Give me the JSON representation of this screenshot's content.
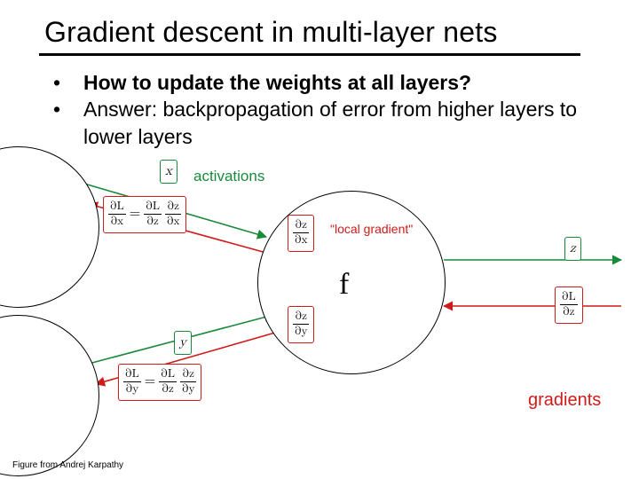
{
  "title": "Gradient descent in multi-layer nets",
  "bullets": {
    "dot": "•",
    "items": [
      {
        "text": "How to update the weights at all layers?",
        "bold": true
      },
      {
        "text": "Answer: backpropagation of error from higher layers to lower layers",
        "bold": false
      }
    ]
  },
  "credit": "Figure from Andrej Karpathy",
  "diagram": {
    "f_label": "f",
    "labels": {
      "activations": "activations",
      "local_gradient": "\"local gradient\"",
      "gradients": "gradients"
    },
    "vars": {
      "x": "x",
      "y": "y",
      "z": "z"
    },
    "math": {
      "dL": "∂L",
      "dx": "∂x",
      "dy": "∂y",
      "dz": "∂z",
      "eq": "="
    }
  },
  "chart_data": {
    "type": "diagram",
    "title": "Backpropagation computational graph node",
    "nodes": [
      {
        "name": "upstream-left-top",
        "shape": "circle-partial"
      },
      {
        "name": "upstream-left-bottom",
        "shape": "circle-partial"
      },
      {
        "name": "f",
        "shape": "circle",
        "label": "f"
      }
    ],
    "inputs": [
      {
        "symbol": "x",
        "activation_color": "green"
      },
      {
        "symbol": "y",
        "activation_color": "green"
      }
    ],
    "output": {
      "symbol": "z",
      "activation_color": "green"
    },
    "forward_edges": [
      {
        "from": "upstream-left-top",
        "to": "f",
        "carries": "x"
      },
      {
        "from": "upstream-left-bottom",
        "to": "f",
        "carries": "y"
      },
      {
        "from": "f",
        "to": "downstream-right",
        "carries": "z"
      }
    ],
    "local_gradients": [
      {
        "expr": "∂z/∂x",
        "box_color": "red"
      },
      {
        "expr": "∂z/∂y",
        "box_color": "red"
      }
    ],
    "incoming_gradient": {
      "expr": "∂L/∂z",
      "box_color": "red"
    },
    "backprop_equations": [
      {
        "lhs": "∂L/∂x",
        "rhs": [
          "∂L/∂z",
          "∂z/∂x"
        ],
        "box_color": "red"
      },
      {
        "lhs": "∂L/∂y",
        "rhs": [
          "∂L/∂z",
          "∂z/∂y"
        ],
        "box_color": "red"
      }
    ],
    "annotations": [
      {
        "text": "activations",
        "color": "green"
      },
      {
        "text": "\"local gradient\"",
        "color": "red"
      },
      {
        "text": "gradients",
        "color": "red"
      }
    ]
  }
}
